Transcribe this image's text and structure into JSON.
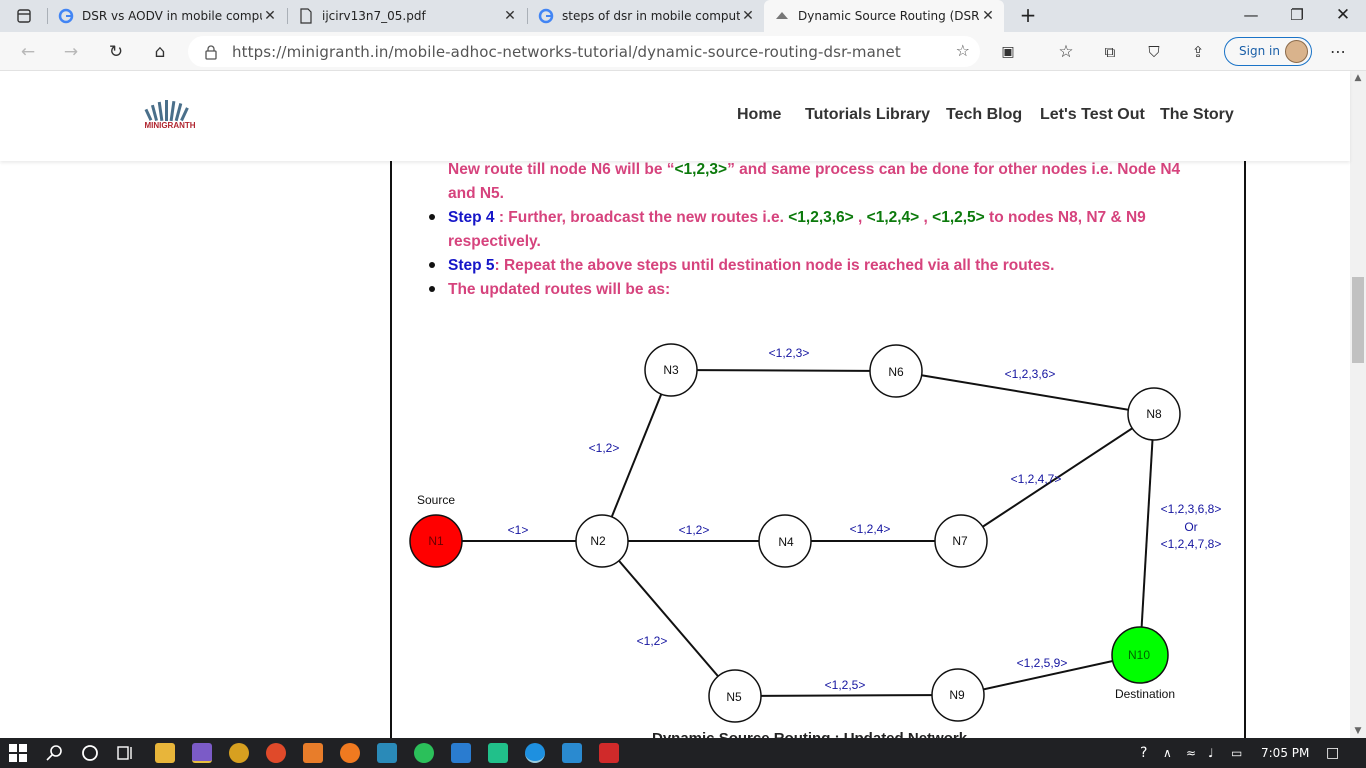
{
  "browser": {
    "tabs": [
      {
        "title": "DSR vs AODV in mobile computi",
        "icon": "google-icon"
      },
      {
        "title": "ijcirv13n7_05.pdf",
        "icon": "document-icon"
      },
      {
        "title": "steps of dsr in mobile computing",
        "icon": "google-icon"
      },
      {
        "title": "Dynamic Source Routing (DSR) |",
        "icon": "minigranth-icon",
        "active": true
      }
    ],
    "url": "https://minigranth.in/mobile-adhoc-networks-tutorial/dynamic-source-routing-dsr-manet",
    "signin_label": "Sign in"
  },
  "site": {
    "logo_text": "MINIGRANTH",
    "nav": [
      "Home",
      "Tutorials Library",
      "Tech Blog",
      "Let's Test Out",
      "The Story"
    ]
  },
  "article": {
    "line1a": "New route till node N6 will be “",
    "line1b": "<1,2,3>",
    "line1c": "” and same process can be done for other nodes i.e. Node N4",
    "line2": "and N5.",
    "step4_label": "Step 4",
    "step4_a": " : Further, broadcast the new routes i.e. ",
    "step4_r1": "<1,2,3,6>",
    "step4_c1": " , ",
    "step4_r2": "<1,2,4>",
    "step4_c2": " , ",
    "step4_r3": "<1,2,5>",
    "step4_b": " to nodes N8, N7 & N9",
    "step4_line2": "respectively.",
    "step5_label": "Step 5",
    "step5_text": ": Repeat the above steps until destination node is reached via all the routes.",
    "updated": "The updated routes will be as:",
    "caption": "Dynamic Source Routing : Updated Network"
  },
  "diagram": {
    "source_label": "Source",
    "destination_label": "Destination",
    "nodes": [
      "N1",
      "N2",
      "N3",
      "N4",
      "N5",
      "N6",
      "N7",
      "N8",
      "N9",
      "N10"
    ],
    "edge_labels": {
      "n1_n2": "<1>",
      "n2_n3": "<1,2>",
      "n2_n4": "<1,2>",
      "n2_n5": "<1,2>",
      "n3_n6": "<1,2,3>",
      "n4_n7": "<1,2,4>",
      "n5_n9": "<1,2,5>",
      "n6_n8": "<1,2,3,6>",
      "n7_n8": "<1,2,4,7>",
      "n9_n10": "<1,2,5,9>",
      "n8_n10_a": "<1,2,3,6,8>",
      "n8_n10_or": "Or",
      "n8_n10_b": "<1,2,4,7,8>"
    },
    "colors": {
      "source": "#ff0000",
      "destination": "#00ff00",
      "label": "#1515a0"
    }
  },
  "taskbar": {
    "time": "7:05 PM"
  }
}
